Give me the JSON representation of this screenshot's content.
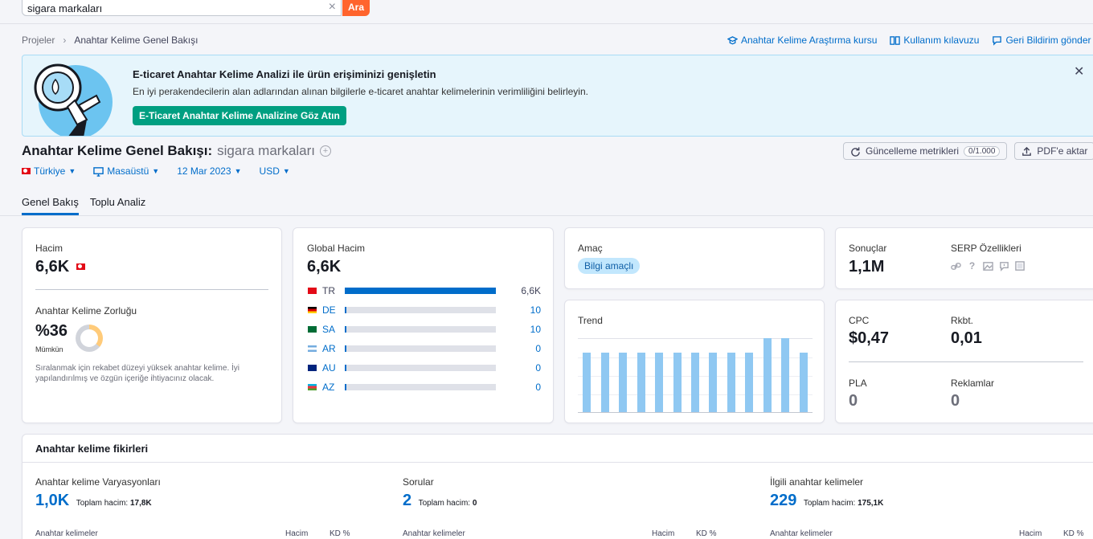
{
  "search": {
    "value": "sigara markaları",
    "button_label": "Ara"
  },
  "breadcrumb": {
    "root": "Projeler",
    "current": "Anahtar Kelime Genel Bakışı"
  },
  "help_links": {
    "course": "Anahtar Kelime Araştırma kursu",
    "manual": "Kullanım kılavuzu",
    "feedback": "Geri Bildirim gönder"
  },
  "banner": {
    "title": "E-ticaret Anahtar Kelime Analizi ile ürün erişiminizi genişletin",
    "text": "En iyi perakendecilerin alan adlarından alınan bilgilerle e-ticaret anahtar kelimelerinin verimliliğini belirleyin.",
    "button_label": "E-Ticaret Anahtar Kelime Analizine Göz Atın"
  },
  "page": {
    "title": "Anahtar Kelime Genel Bakışı:",
    "keyword": "sigara markaları",
    "update_label": "Güncelleme metrikleri",
    "update_quota": "0/1.000",
    "pdf_label": "PDF'e aktar"
  },
  "filters": {
    "country": "Türkiye",
    "device": "Masaüstü",
    "date": "12 Mar 2023",
    "currency": "USD"
  },
  "tabs": [
    "Genel Bakış",
    "Toplu Analiz"
  ],
  "volume": {
    "label": "Hacim",
    "value": "6,6K",
    "kd_label": "Anahtar Kelime Zorluğu",
    "kd_value": "%36",
    "kd_level": "Mümkün",
    "kd_percent": 36,
    "kd_note": "Sıralanmak için rekabet düzeyi yüksek anahtar kelime. İyi yapılandırılmış ve özgün içeriğe ihtiyacınız olacak."
  },
  "global_volume": {
    "label": "Global Hacim",
    "value": "6,6K",
    "rows": [
      {
        "code": "TR",
        "value": "6,6K",
        "share": 1.0
      },
      {
        "code": "DE",
        "value": "10",
        "share": 0.01
      },
      {
        "code": "SA",
        "value": "10",
        "share": 0.01
      },
      {
        "code": "AR",
        "value": "0",
        "share": 0.01
      },
      {
        "code": "AU",
        "value": "0",
        "share": 0.01
      },
      {
        "code": "AZ",
        "value": "0",
        "share": 0.01
      }
    ]
  },
  "intent": {
    "label": "Amaç",
    "badge": "Bilgi amaçlı"
  },
  "trend": {
    "label": "Trend",
    "values": [
      0.8,
      0.8,
      0.8,
      0.8,
      0.8,
      0.8,
      0.8,
      0.8,
      0.8,
      0.8,
      1.0,
      1.0,
      0.8
    ]
  },
  "results": {
    "label": "Sonuçlar",
    "value": "1,1M",
    "serp_label": "SERP Özellikleri"
  },
  "cpc": {
    "cpc_label": "CPC",
    "cpc_value": "$0,47",
    "comp_label": "Rkbt.",
    "comp_value": "0,01",
    "pla_label": "PLA",
    "pla_value": "0",
    "ads_label": "Reklamlar",
    "ads_value": "0"
  },
  "ideas": {
    "title": "Anahtar kelime fikirleri",
    "total_label": "Toplam hacim:",
    "columns": [
      {
        "heading": "Anahtar kelime Varyasyonları",
        "count": "1,0K",
        "total": "17,8K"
      },
      {
        "heading": "Sorular",
        "count": "2",
        "total": "0"
      },
      {
        "heading": "İlgili anahtar kelimeler",
        "count": "229",
        "total": "175,1K"
      }
    ],
    "table_head": {
      "keyword": "Anahtar kelimeler",
      "volume": "Hacim",
      "kd": "KD %"
    }
  },
  "colors": {
    "accent": "#006dca",
    "search_button": "#ff642d",
    "banner_button": "#009f81",
    "trend_bar": "#8fc8f2"
  }
}
